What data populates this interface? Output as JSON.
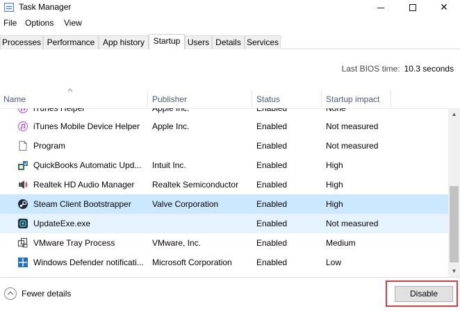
{
  "window": {
    "title": "Task Manager"
  },
  "menu": {
    "file": "File",
    "options": "Options",
    "view": "View"
  },
  "tabs": [
    "Processes",
    "Performance",
    "App history",
    "Startup",
    "Users",
    "Details",
    "Services"
  ],
  "active_tab": "Startup",
  "bios": {
    "label": "Last BIOS time:",
    "value": "10.3 seconds"
  },
  "columns": {
    "name": "Name",
    "publisher": "Publisher",
    "status": "Status",
    "impact": "Startup impact"
  },
  "rows": [
    {
      "name": "iTunes Helper",
      "publisher": "Apple Inc.",
      "status": "Enabled",
      "impact": "None",
      "icon": "itunes-icon"
    },
    {
      "name": "iTunes Mobile Device Helper",
      "publisher": "Apple Inc.",
      "status": "Enabled",
      "impact": "Not measured",
      "icon": "itunes-icon"
    },
    {
      "name": "Program",
      "publisher": "",
      "status": "Enabled",
      "impact": "Not measured",
      "icon": "blank-document-icon"
    },
    {
      "name": "QuickBooks Automatic Upd...",
      "publisher": "Intuit Inc.",
      "status": "Enabled",
      "impact": "High",
      "icon": "quickbooks-icon"
    },
    {
      "name": "Realtek HD Audio Manager",
      "publisher": "Realtek Semiconductor",
      "status": "Enabled",
      "impact": "High",
      "icon": "speaker-icon"
    },
    {
      "name": "Steam Client Bootstrapper",
      "publisher": "Valve Corporation",
      "status": "Enabled",
      "impact": "High",
      "icon": "steam-icon"
    },
    {
      "name": "UpdateExe.exe",
      "publisher": "",
      "status": "Enabled",
      "impact": "Not measured",
      "icon": "update-app-icon"
    },
    {
      "name": "VMware Tray Process",
      "publisher": "VMware, Inc.",
      "status": "Enabled",
      "impact": "Medium",
      "icon": "vmware-icon"
    },
    {
      "name": "Windows Defender notificati...",
      "publisher": "Microsoft Corporation",
      "status": "Enabled",
      "impact": "Low",
      "icon": "windows-defender-icon"
    }
  ],
  "selected_row": "Steam Client Bootstrapper",
  "hovered_row": "UpdateExe.exe",
  "footer": {
    "fewer_details": "Fewer details",
    "disable": "Disable"
  },
  "colors": {
    "selection": "#cce8ff",
    "hover": "#e5f3ff",
    "highlight_outline": "#e0393f",
    "header_text": "#4b5b72"
  }
}
